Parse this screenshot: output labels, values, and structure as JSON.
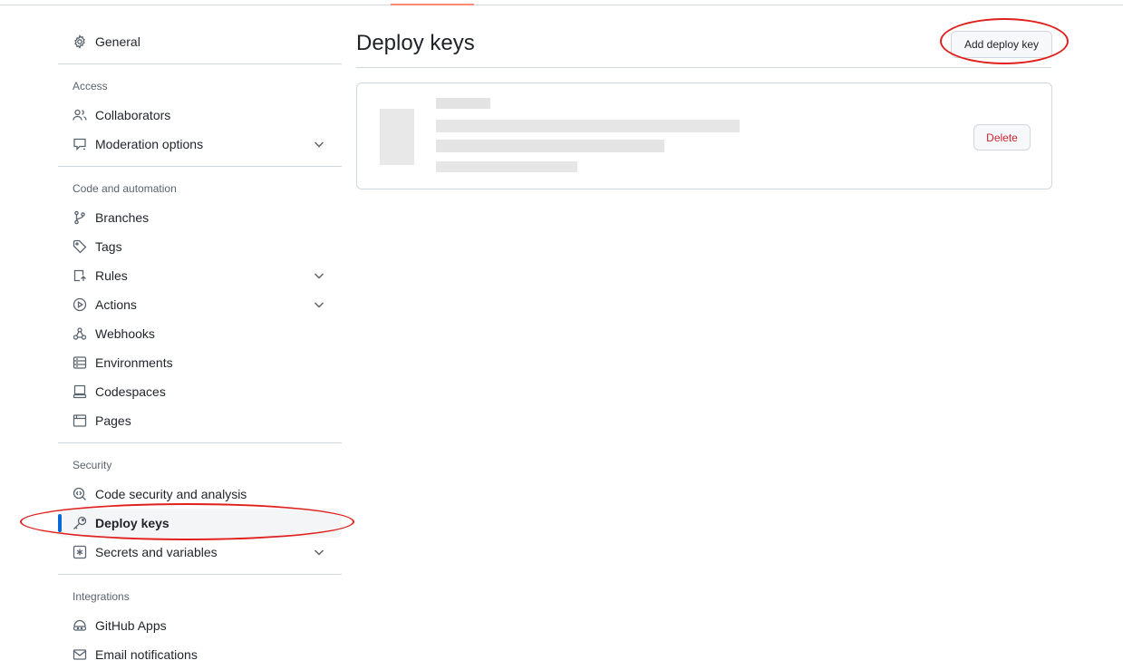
{
  "sidebar": {
    "general": "General",
    "groups": [
      {
        "heading": "Access",
        "items": [
          {
            "label": "Collaborators",
            "icon": "people-icon"
          },
          {
            "label": "Moderation options",
            "icon": "report-icon",
            "expandable": true
          }
        ]
      },
      {
        "heading": "Code and automation",
        "items": [
          {
            "label": "Branches",
            "icon": "branch-icon"
          },
          {
            "label": "Tags",
            "icon": "tag-icon"
          },
          {
            "label": "Rules",
            "icon": "rules-icon",
            "expandable": true
          },
          {
            "label": "Actions",
            "icon": "play-icon",
            "expandable": true
          },
          {
            "label": "Webhooks",
            "icon": "webhook-icon"
          },
          {
            "label": "Environments",
            "icon": "server-icon"
          },
          {
            "label": "Codespaces",
            "icon": "codespaces-icon"
          },
          {
            "label": "Pages",
            "icon": "browser-icon"
          }
        ]
      },
      {
        "heading": "Security",
        "items": [
          {
            "label": "Code security and analysis",
            "icon": "codescan-icon"
          },
          {
            "label": "Deploy keys",
            "icon": "key-icon",
            "active": true
          },
          {
            "label": "Secrets and variables",
            "icon": "asterisk-icon",
            "expandable": true
          }
        ]
      },
      {
        "heading": "Integrations",
        "items": [
          {
            "label": "GitHub Apps",
            "icon": "apps-icon"
          },
          {
            "label": "Email notifications",
            "icon": "mail-icon"
          }
        ]
      }
    ]
  },
  "main": {
    "title": "Deploy keys",
    "add_button": "Add deploy key",
    "key": {
      "delete_button": "Delete"
    }
  },
  "colors": {
    "accent": "#0969da",
    "danger": "#d1242f",
    "annotation": "#e0201c",
    "tab_underline": "#fd8c73"
  }
}
